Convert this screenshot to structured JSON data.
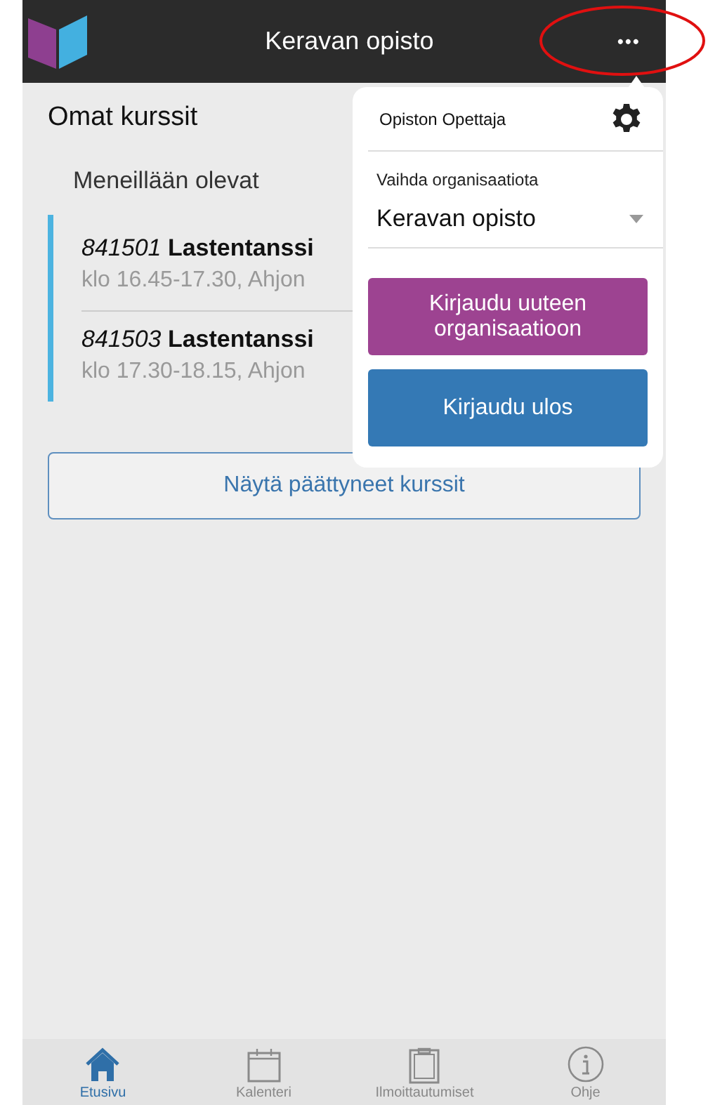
{
  "header": {
    "title": "Keravan opisto",
    "menu_glyph": "•••"
  },
  "page": {
    "title": "Omat kurssit",
    "section": "Meneillään olevat",
    "courses": [
      {
        "code": "841501",
        "name": "Lastentanssi",
        "details": "klo 16.45-17.30, Ahjon"
      },
      {
        "code": "841503",
        "name": "Lastentanssi",
        "details": "klo 17.30-18.15, Ahjon"
      }
    ],
    "show_past_button": "Näytä päättyneet kurssit"
  },
  "menu": {
    "user": "Opiston Opettaja",
    "org_label": "Vaihda organisaatiota",
    "org_value": "Keravan opisto",
    "buttons": [
      {
        "label": "Kirjaudu uuteen organisaatioon",
        "color": "#9d4391"
      },
      {
        "label": "Kirjaudu ulos",
        "color": "#3479b5"
      }
    ]
  },
  "tabs": [
    {
      "label": "Etusivu",
      "kind": "home",
      "selected": true
    },
    {
      "label": "Kalenteri",
      "kind": "calendar",
      "selected": false
    },
    {
      "label": "Ilmoittautumiset",
      "kind": "clipboard",
      "selected": false
    },
    {
      "label": "Ohje",
      "kind": "info",
      "selected": false
    }
  ]
}
